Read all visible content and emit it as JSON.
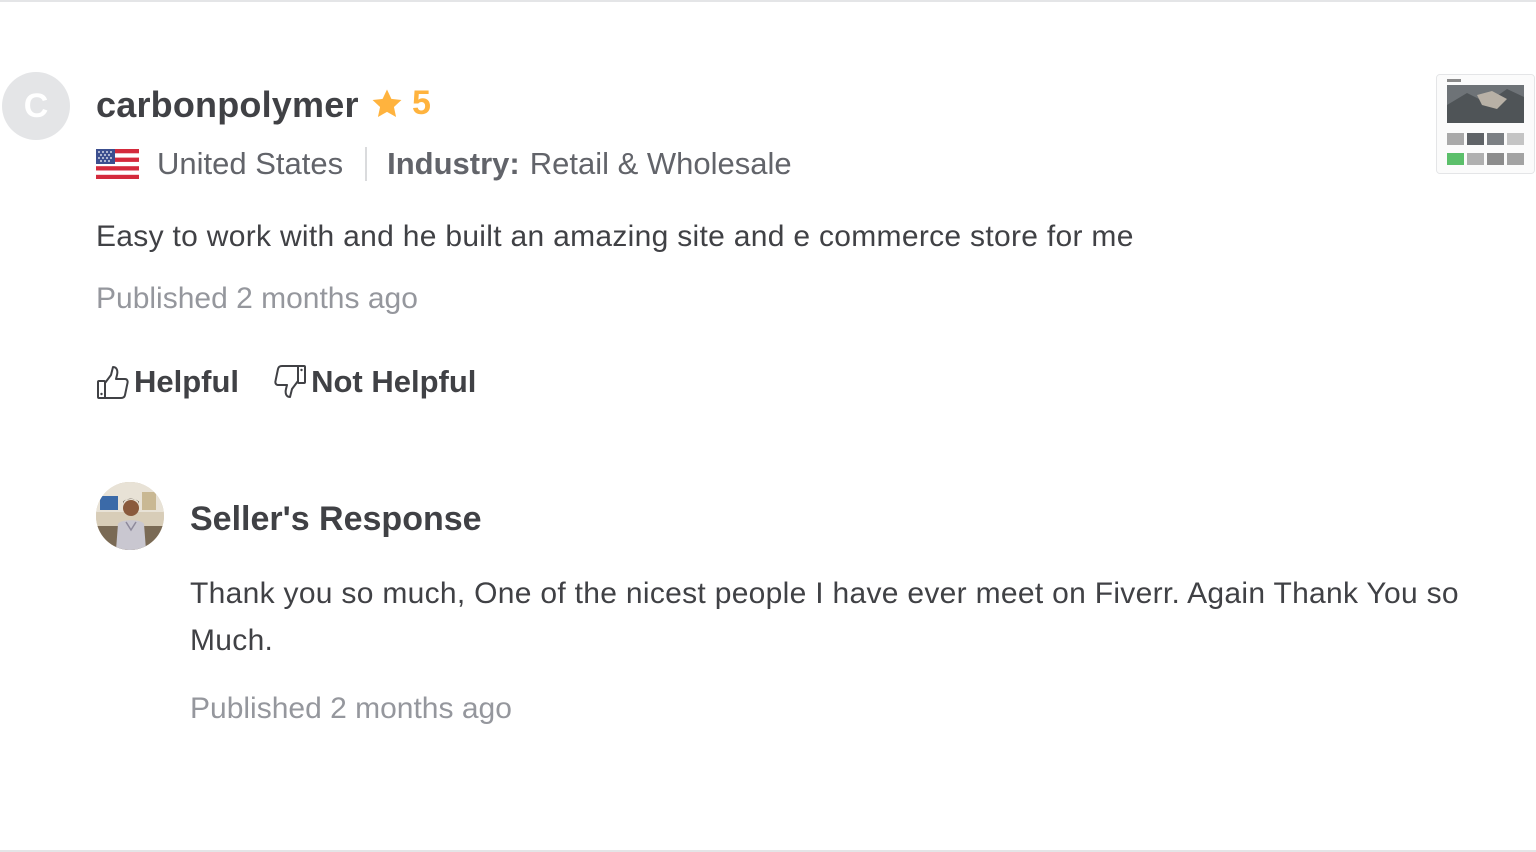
{
  "review": {
    "avatar_letter": "C",
    "username": "carbonpolymer",
    "rating": "5",
    "country": "United States",
    "industry_label": "Industry:",
    "industry_value": "Retail & Wholesale",
    "text": "Easy to work with and he built an amazing site and e commerce store for me",
    "published": "Published 2 months ago"
  },
  "actions": {
    "helpful_label": "Helpful",
    "not_helpful_label": "Not Helpful"
  },
  "seller_response": {
    "title": "Seller's Response",
    "text": "Thank you so much, One of the nicest people I have ever meet on Fiverr. Again Thank You so Much.",
    "published": "Published 2 months ago"
  },
  "icons": {
    "star": "star-icon",
    "flag": "us-flag-icon",
    "helpful": "thumbs-up-icon",
    "not_helpful": "thumbs-down-icon"
  },
  "colors": {
    "star": "#ffb33e",
    "text_primary": "#404145",
    "text_secondary": "#62646a",
    "text_muted": "#95979d"
  }
}
